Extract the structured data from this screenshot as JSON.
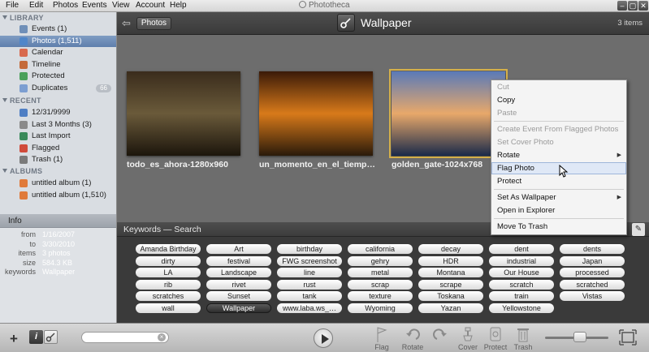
{
  "window": {
    "title": "Phototheca",
    "menus": [
      "File",
      "Edit",
      "Photos",
      "Events",
      "View",
      "Account",
      "Help"
    ],
    "controls": [
      "‒",
      "▢",
      "✕"
    ]
  },
  "sidebar": {
    "library_label": "LIBRARY",
    "recent_label": "RECENT",
    "albums_label": "ALBUMS",
    "library_items": [
      {
        "label": "Events (1)",
        "icon": "calendar-icon",
        "color": "#6f8fb8"
      },
      {
        "label": "Photos (1,511)",
        "icon": "photos-icon",
        "color": "#4f86c9",
        "selected": true
      },
      {
        "label": "Calendar",
        "icon": "calendar-icon",
        "color": "#d86a4f"
      },
      {
        "label": "Timeline",
        "icon": "timeline-icon",
        "color": "#c46a3a"
      },
      {
        "label": "Protected",
        "icon": "lock-icon",
        "color": "#4aa05a"
      },
      {
        "label": "Duplicates",
        "icon": "duplicates-icon",
        "color": "#7c9ed1",
        "badge": "66"
      }
    ],
    "recent_items": [
      {
        "label": "12/31/9999",
        "icon": "calendar-icon",
        "color": "#4f7fc4"
      },
      {
        "label": "Last 3 Months (3)",
        "icon": "clock-icon",
        "color": "#8a8a8a"
      },
      {
        "label": "Last Import",
        "icon": "import-icon",
        "color": "#3a8a5a"
      },
      {
        "label": "Flagged",
        "icon": "flag-icon",
        "color": "#d04a3a"
      },
      {
        "label": "Trash (1)",
        "icon": "trash-icon",
        "color": "#7a7a7a"
      }
    ],
    "album_items": [
      {
        "label": "untitled album (1)",
        "icon": "album-icon",
        "color": "#e07a3a"
      },
      {
        "label": "untitled album (1,510)",
        "icon": "album-icon",
        "color": "#e07a3a"
      }
    ]
  },
  "info": {
    "title": "Info",
    "rows": [
      {
        "key": "from",
        "value": "1/16/2007"
      },
      {
        "key": "to",
        "value": "3/30/2010"
      },
      {
        "key": "items",
        "value": "3 photos"
      },
      {
        "key": "size",
        "value": "584.3 KB"
      },
      {
        "key": "keywords",
        "value": "Wallpaper"
      }
    ]
  },
  "topbar": {
    "back_button": "Photos",
    "event_title": "Wallpaper",
    "item_count": "3 items"
  },
  "photos": [
    {
      "caption": "todo_es_ahora-1280x960",
      "colors": [
        "#3a2c1c",
        "#6a5a3a",
        "#1c150c"
      ],
      "selected": false
    },
    {
      "caption": "un_momento_en_el_tiemp…",
      "colors": [
        "#3a1a08",
        "#d87a1a",
        "#2a1a0a"
      ],
      "selected": false
    },
    {
      "caption": "golden_gate-1024x768",
      "colors": [
        "#5a7ab8",
        "#e8a86a",
        "#1a2a4a"
      ],
      "selected": true
    }
  ],
  "context_menu": {
    "items": [
      {
        "label": "Cut",
        "disabled": true
      },
      {
        "label": "Copy",
        "disabled": false
      },
      {
        "label": "Paste",
        "disabled": true
      },
      {
        "label": "Create Event From Flagged Photos",
        "disabled": true
      },
      {
        "label": "Set Cover Photo",
        "disabled": true
      },
      {
        "label": "Rotate",
        "disabled": false,
        "submenu": true
      },
      {
        "label": "Flag Photo",
        "disabled": false,
        "hover": true
      },
      {
        "label": "Protect",
        "disabled": false
      },
      {
        "label": "Set As Wallpaper",
        "disabled": false,
        "submenu": true
      },
      {
        "label": "Open in Explorer",
        "disabled": false
      },
      {
        "label": "Move To Trash",
        "disabled": false
      }
    ]
  },
  "keywords": {
    "title": "Keywords — Search",
    "items": [
      "Amanda Birthday",
      "Art",
      "birthday",
      "california",
      "decay",
      "dent",
      "dents",
      "dirty",
      "festival",
      "FWG screenshot",
      "gehry",
      "HDR",
      "industrial",
      "Japan",
      "LA",
      "Landscape",
      "line",
      "metal",
      "Montana",
      "Our House",
      "processed",
      "rib",
      "rivet",
      "rust",
      "scrap",
      "scrape",
      "scratch",
      "scratched",
      "scratches",
      "Sunset",
      "tank",
      "texture",
      "Toskana",
      "train",
      "Vistas",
      "wall",
      "Wallpaper",
      "www.laba.ws_…",
      "Wyoming",
      "Yazan",
      "Yellowstone"
    ],
    "selected": "Wallpaper"
  },
  "bottombar": {
    "search_value": "",
    "tools": [
      {
        "label": "Flag",
        "icon": "flag-icon"
      },
      {
        "label": "Rotate",
        "icon": "rotate-left-icon"
      },
      {
        "label": "",
        "icon": "rotate-right-icon"
      },
      {
        "label": "Cover",
        "icon": "cover-icon"
      },
      {
        "label": "Protect",
        "icon": "protect-icon"
      },
      {
        "label": "Trash",
        "icon": "trash-icon"
      }
    ],
    "zoom_level": 0.55
  }
}
